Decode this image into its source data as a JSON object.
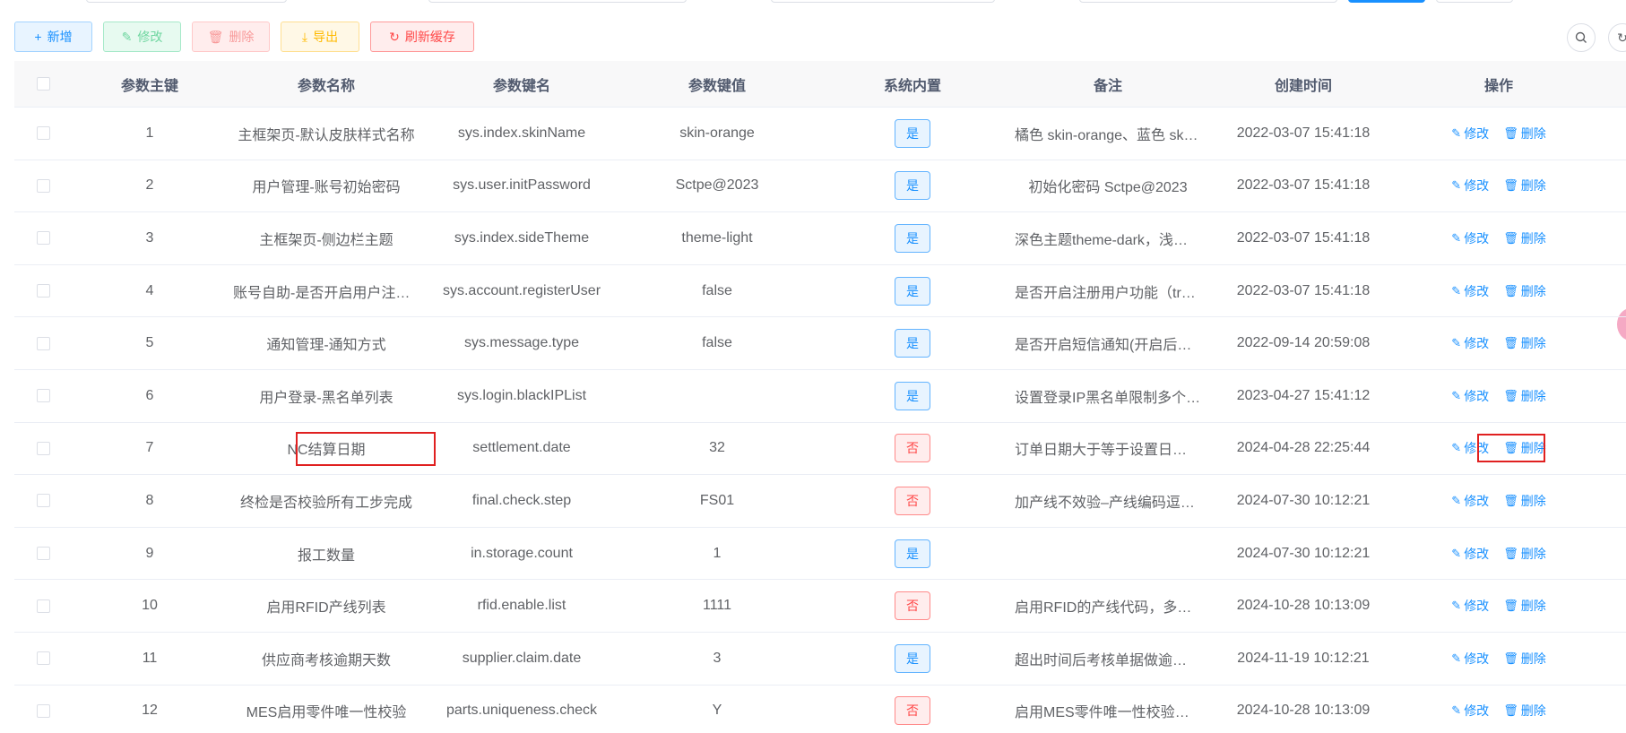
{
  "toolbar": {
    "add_label": "新增",
    "edit_label": "修改",
    "delete_label": "删除",
    "export_label": "导出",
    "refresh_label": "刷新缓存"
  },
  "icons": {
    "add": "plus-icon",
    "edit": "pencil-icon",
    "delete": "trash-icon",
    "export": "download-icon",
    "refresh": "refresh-icon",
    "search": "search-icon",
    "reload": "reload-icon"
  },
  "colors": {
    "primary": "#1890ff",
    "success": "#13ce66",
    "danger": "#ff4949",
    "warning": "#ffba00",
    "highlight": "#e02020"
  },
  "table": {
    "headers": {
      "id": "参数主键",
      "name": "参数名称",
      "key": "参数键名",
      "value": "参数键值",
      "system": "系统内置",
      "remark": "备注",
      "created": "创建时间",
      "ops": "操作"
    },
    "op_edit": "修改",
    "op_delete": "删除",
    "rows": [
      {
        "id": "1",
        "name": "主框架页-默认皮肤样式名称",
        "key": "sys.index.skinName",
        "value": "skin-orange",
        "system": "是",
        "builtin": true,
        "remark": "橘色 skin-orange、蓝色 skin-blue",
        "created": "2022-03-07 15:41:18"
      },
      {
        "id": "2",
        "name": "用户管理-账号初始密码",
        "key": "sys.user.initPassword",
        "value": "Sctpe@2023",
        "system": "是",
        "builtin": true,
        "remark": "初始化密码 Sctpe@2023",
        "created": "2022-03-07 15:41:18"
      },
      {
        "id": "3",
        "name": "主框架页-侧边栏主题",
        "key": "sys.index.sideTheme",
        "value": "theme-light",
        "system": "是",
        "builtin": true,
        "remark": "深色主题theme-dark，浅色主题",
        "created": "2022-03-07 15:41:18"
      },
      {
        "id": "4",
        "name": "账号自助-是否开启用户注册功能",
        "key": "sys.account.registerUser",
        "value": "false",
        "system": "是",
        "builtin": true,
        "remark": "是否开启注册用户功能（true开启）",
        "created": "2022-03-07 15:41:18"
      },
      {
        "id": "5",
        "name": "通知管理-通知方式",
        "key": "sys.message.type",
        "value": "false",
        "system": "是",
        "builtin": true,
        "remark": "是否开启短信通知(开启后通知)",
        "created": "2022-09-14 20:59:08"
      },
      {
        "id": "6",
        "name": "用户登录-黑名单列表",
        "key": "sys.login.blackIPList",
        "value": "",
        "system": "是",
        "builtin": true,
        "remark": "设置登录IP黑名单限制多个匹配项",
        "created": "2023-04-27 15:41:12"
      },
      {
        "id": "7",
        "name": "NC结算日期",
        "key": "settlement.date",
        "value": "32",
        "system": "否",
        "builtin": false,
        "remark": "订单日期大于等于设置日期的订单",
        "created": "2024-04-28 22:25:44"
      },
      {
        "id": "8",
        "name": "终检是否校验所有工步完成",
        "key": "final.check.step",
        "value": "FS01",
        "system": "否",
        "builtin": false,
        "remark": "加产线不效验–产线编码逗号分隔",
        "created": "2024-07-30 10:12:21"
      },
      {
        "id": "9",
        "name": "报工数量",
        "key": "in.storage.count",
        "value": "1",
        "system": "是",
        "builtin": true,
        "remark": "",
        "created": "2024-07-30 10:12:21"
      },
      {
        "id": "10",
        "name": "启用RFID产线列表",
        "key": "rfid.enable.list",
        "value": "1111",
        "system": "否",
        "builtin": false,
        "remark": "启用RFID的产线代码，多个逗号分隔",
        "created": "2024-10-28 10:13:09"
      },
      {
        "id": "11",
        "name": "供应商考核逾期天数",
        "key": "supplier.claim.date",
        "value": "3",
        "system": "是",
        "builtin": true,
        "remark": "超出时间后考核单据做逾期处理",
        "created": "2024-11-19 10:12:21"
      },
      {
        "id": "12",
        "name": "MES启用零件唯一性校验",
        "key": "parts.uniqueness.check",
        "value": "Y",
        "system": "否",
        "builtin": false,
        "remark": "启用MES零件唯一性校验功能",
        "created": "2024-10-28 10:13:09"
      }
    ]
  }
}
